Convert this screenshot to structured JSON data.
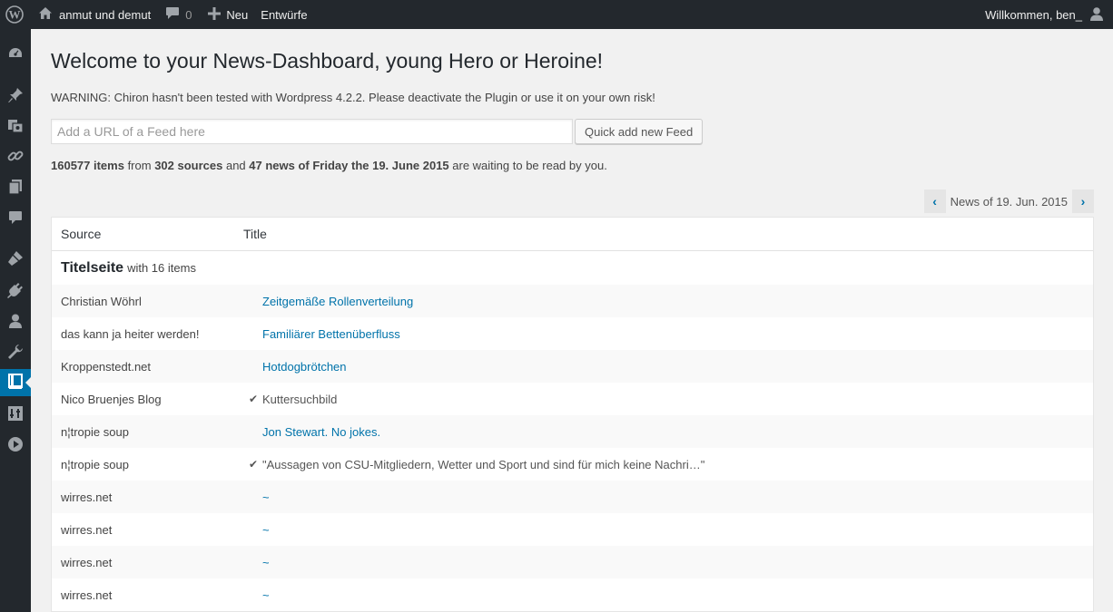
{
  "adminbar": {
    "site_name": "anmut und demut",
    "comment_count": "0",
    "new_label": "Neu",
    "drafts_label": "Entwürfe",
    "greeting": "Willkommen, ben_"
  },
  "adminmenu": {
    "icons": [
      "dashboard-icon",
      "pin-icon",
      "media-icon",
      "links-icon",
      "pages-icon",
      "comments-icon",
      "appearance-icon",
      "plugins-icon",
      "users-icon",
      "tools-icon",
      "news-icon",
      "settings-icon",
      "play-icon"
    ],
    "current": "news-icon"
  },
  "page": {
    "title": "Welcome to your News-Dashboard, young Hero or Heroine!",
    "warning": "WARNING: Chiron hasn't been tested with Wordpress 4.2.2. Please deactivate the Plugin or use it on your own risk!",
    "feed_input_placeholder": "Add a URL of a Feed here",
    "feed_input_value": "",
    "quick_add_label": "Quick add new Feed",
    "stats": {
      "items_count": "160577 items",
      "from": " from ",
      "sources_count": "302 sources",
      "and": " and ",
      "news_count": "47 news of Friday the 19. June 2015",
      "suffix": " are waiting to be read by you."
    },
    "pager": {
      "prev": "‹",
      "label": "News of 19. Jun. 2015",
      "next": "›"
    }
  },
  "table": {
    "headers": {
      "source": "Source",
      "title": "Title"
    },
    "group": {
      "name": "Titelseite",
      "count_text": "with 16 items"
    },
    "rows": [
      {
        "source": "Christian Wöhrl",
        "title": "Zeitgemäße Rollenverteilung",
        "read": false
      },
      {
        "source": "das kann ja heiter werden!",
        "title": "Familiärer Bettenüberfluss",
        "read": false
      },
      {
        "source": "Kroppenstedt.net",
        "title": "Hotdogbrötchen",
        "read": false
      },
      {
        "source": "Nico Bruenjes Blog",
        "title": "Kuttersuchbild",
        "read": true
      },
      {
        "source": "n¦tropie soup",
        "title": "Jon Stewart. No jokes.",
        "read": false
      },
      {
        "source": "n¦tropie soup",
        "title": "\"Aussagen von CSU-Mitgliedern, Wetter und Sport und sind für mich keine Nachri…\"",
        "read": true
      },
      {
        "source": "wirres.net",
        "title": "~",
        "read": false
      },
      {
        "source": "wirres.net",
        "title": "~",
        "read": false
      },
      {
        "source": "wirres.net",
        "title": "~",
        "read": false
      },
      {
        "source": "wirres.net",
        "title": "~",
        "read": false
      }
    ],
    "read_mark": "✔"
  },
  "colors": {
    "adminbar_bg": "#23282d",
    "accent": "#0073aa",
    "page_bg": "#f1f1f1"
  }
}
